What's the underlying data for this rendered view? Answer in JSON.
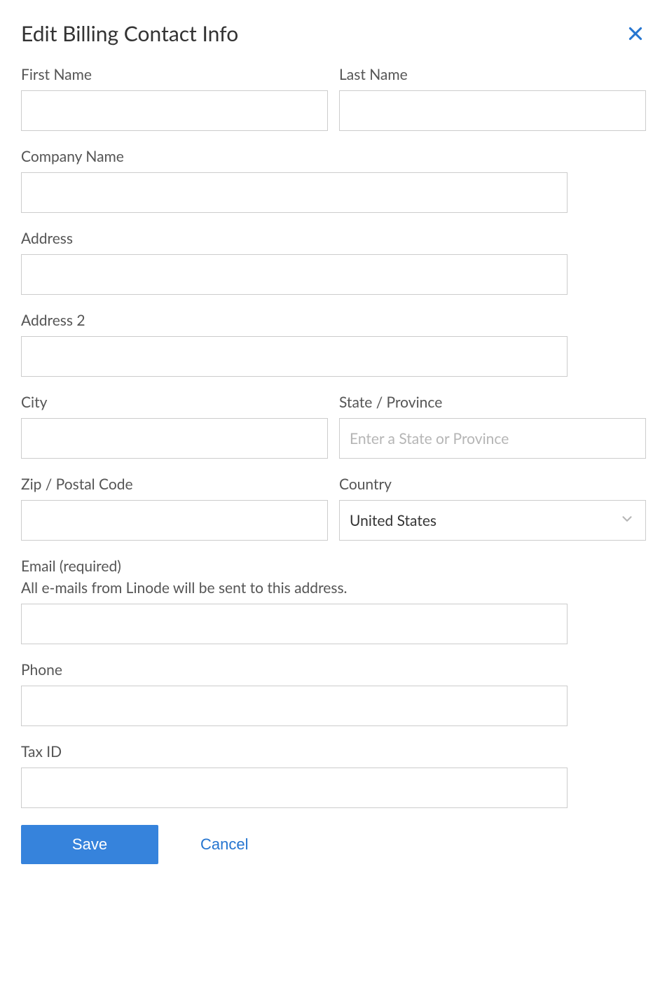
{
  "header": {
    "title": "Edit Billing Contact Info"
  },
  "form": {
    "first_name": {
      "label": "First Name",
      "value": ""
    },
    "last_name": {
      "label": "Last Name",
      "value": ""
    },
    "company_name": {
      "label": "Company Name",
      "value": ""
    },
    "address": {
      "label": "Address",
      "value": ""
    },
    "address2": {
      "label": "Address 2",
      "value": ""
    },
    "city": {
      "label": "City",
      "value": ""
    },
    "state": {
      "label": "State / Province",
      "placeholder": "Enter a State or Province",
      "value": ""
    },
    "zip": {
      "label": "Zip / Postal Code",
      "value": ""
    },
    "country": {
      "label": "Country",
      "value": "United States"
    },
    "email": {
      "label": "Email (required)",
      "hint": "All e-mails from Linode will be sent to this address.",
      "value": ""
    },
    "phone": {
      "label": "Phone",
      "value": ""
    },
    "tax_id": {
      "label": "Tax ID",
      "value": ""
    }
  },
  "actions": {
    "save": "Save",
    "cancel": "Cancel"
  }
}
